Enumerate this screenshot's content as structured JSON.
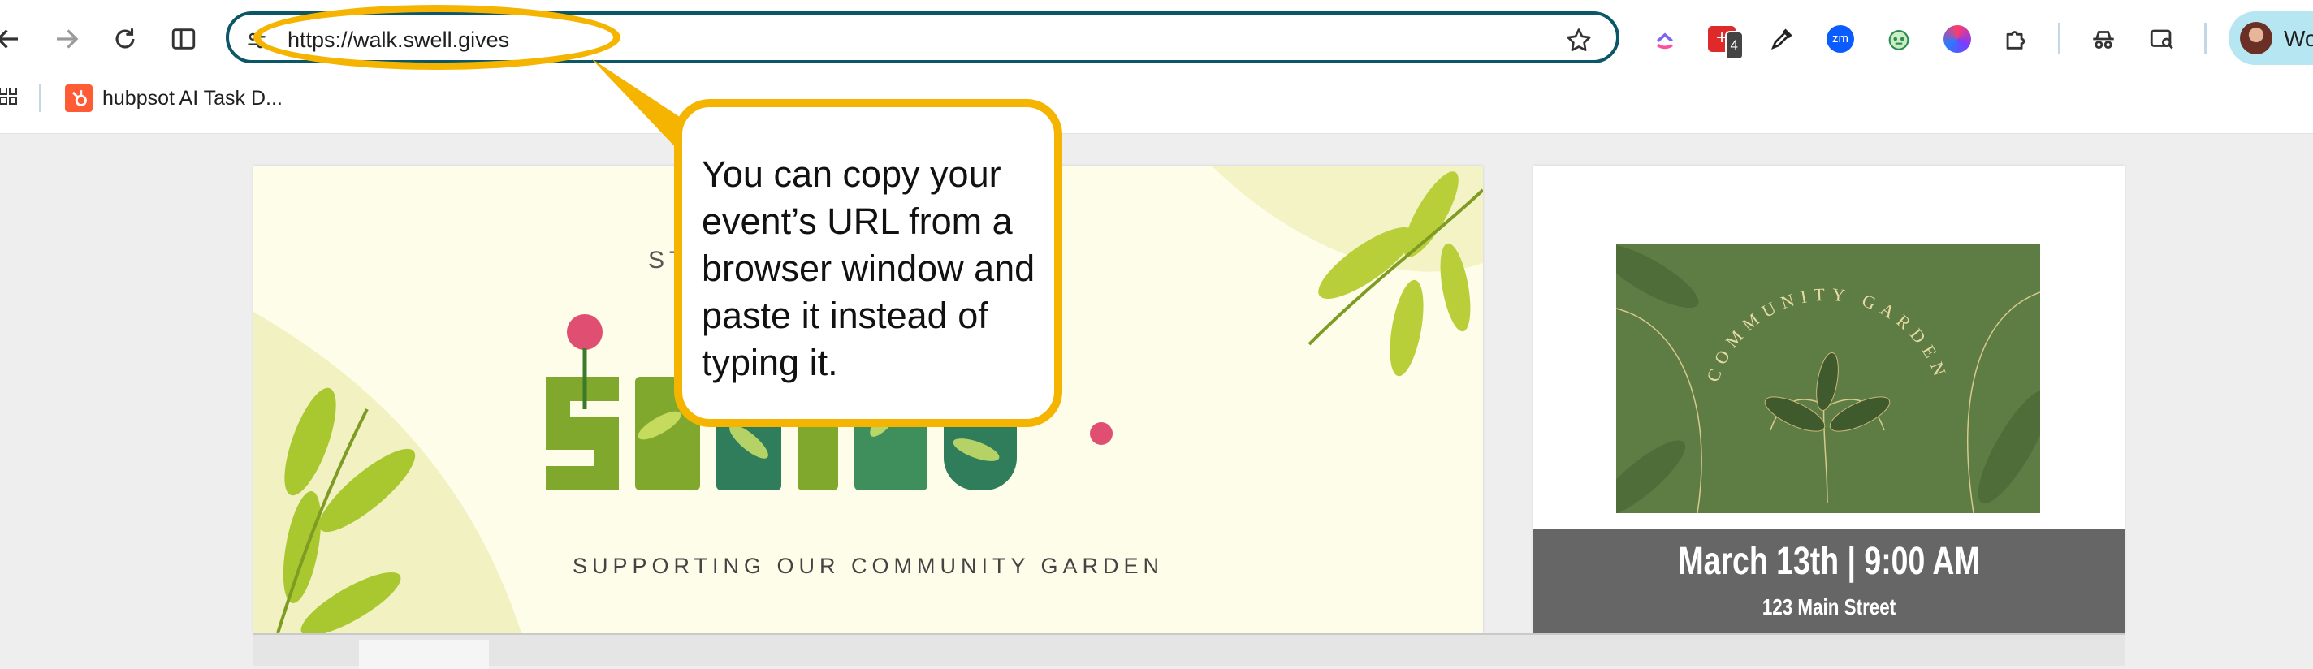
{
  "browser": {
    "url": "https://walk.swell.gives",
    "extensions": {
      "badge_count": "4",
      "zoom_label": "zm"
    },
    "profile_label": "Wo",
    "bookmarks": [
      {
        "label": "hubpsot AI Task D..."
      }
    ],
    "colors": {
      "omnibox_border": "#0b5768",
      "profile_bg": "#b7e6f3"
    }
  },
  "page": {
    "hero": {
      "kicker": "ST",
      "subtitle": "SUPPORTING OUR COMMUNITY GARDEN"
    },
    "event_card": {
      "image_title": "COMMUNITY GARDEN",
      "date_time": "March 13th | 9:00 AM",
      "address": "123 Main Street"
    }
  },
  "annotation": {
    "callout_text": "You can copy your event’s URL from a browser window and paste it instead of typing it.",
    "color": "#f4b400"
  }
}
